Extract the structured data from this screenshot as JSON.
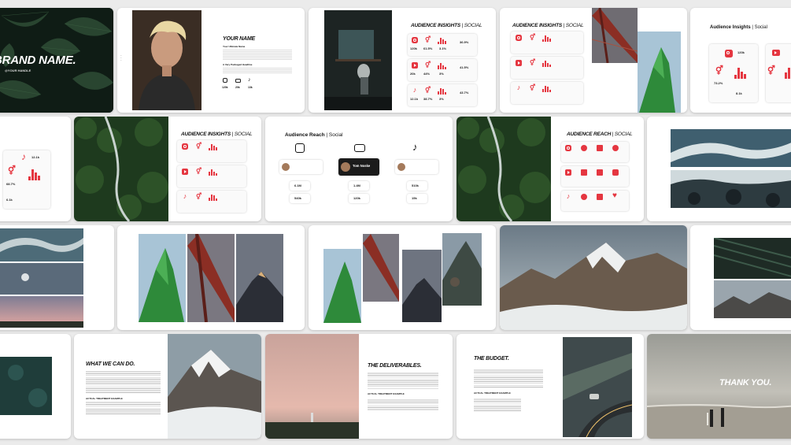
{
  "slides": {
    "cover": {
      "brand": "BRAND NAME.",
      "handle": "@YOUR HANDLE"
    },
    "profile": {
      "title": "YOUR NAME",
      "subtitle": "Your Ultimate Name",
      "section": "A Very Packaged Headline",
      "stats": [
        "120k",
        "20k",
        "13k"
      ]
    },
    "insights": {
      "title_bold": "AUDIENCE INSIGHTS",
      "title_light": "| SOCIAL"
    },
    "insights_small": {
      "title_bold": "Audience Insights",
      "title_light": "| Social",
      "followers": "120k",
      "engagement": "8.1k",
      "audience": "73.2%"
    },
    "tiktok_card": {
      "followers": "12.1k",
      "stat1": "68.7%",
      "stat2": "6.1k"
    },
    "reach": {
      "title_bold": "Audience Reach",
      "title_light": "| Social",
      "person": "Tom Noske",
      "metrics": [
        "6.1M",
        "540k",
        "1.4M",
        "120k",
        "510k",
        "15k"
      ]
    },
    "reach_social": {
      "title_bold": "AUDIENCE REACH",
      "title_light": "| SOCIAL"
    },
    "we_can_do": {
      "title": "WHAT WE CAN DO.",
      "sub": "ACTUAL TREATMENT EXAMPLE"
    },
    "deliverables": {
      "title": "THE DELIVERABLES.",
      "sub": "ACTUAL TREATMENT EXAMPLE"
    },
    "budget": {
      "title": "THE BUDGET.",
      "sub": "ACTUAL TREATMENT EXAMPLE"
    },
    "thanks": {
      "title": "THANK YOU."
    },
    "insight_values": {
      "r1": [
        "120k",
        "61.5%",
        "3.1%",
        "36.9%"
      ],
      "r2": [
        "20k",
        "44%",
        "3%",
        "41.5%"
      ],
      "r3": [
        "12.1k",
        "38.7%",
        "3%",
        "43.7%"
      ]
    }
  },
  "colors": {
    "accent": "#e53640",
    "background": "#ebebeb",
    "slide": "#ffffff"
  }
}
